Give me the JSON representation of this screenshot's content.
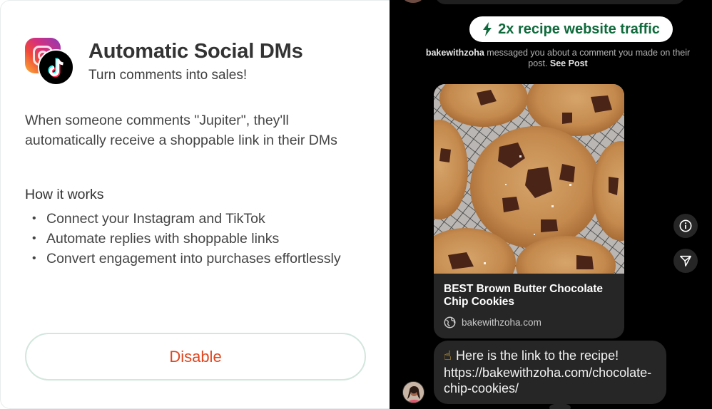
{
  "left_panel": {
    "title": "Automatic Social DMs",
    "subtitle": "Turn comments into sales!",
    "description": "When someone comments \"Jupiter\", they'll automatically receive a shoppable link in their DMs",
    "how_it_works_heading": "How it works",
    "bullets": [
      "Connect your Instagram and TikTok",
      "Automate replies with shoppable links",
      "Convert engagement into purchases effortlessly"
    ],
    "disable_label": "Disable",
    "icons": [
      "instagram-logo",
      "tiktok-logo"
    ]
  },
  "preview": {
    "badge_text": "2x recipe website traffic",
    "badge_icon": "lightning-icon",
    "notice_user": "bakewithzoha",
    "notice_text": "messaged you about a comment you made on their post.",
    "notice_link": "See Post",
    "card": {
      "title": "BEST Brown Butter Chocolate Chip Cookies",
      "site": "bakewithzoha.com"
    },
    "message_emoji": "☝",
    "message_text": "Here is the link to the recipe!",
    "message_link": "https://bakewithzoha.com/chocolate-chip-cookies/",
    "side_icons": [
      "info-icon",
      "send-icon"
    ]
  },
  "colors": {
    "accent_green": "#0e6a3b",
    "disable_red": "#e0461f",
    "button_border": "#d3e6dd",
    "dark_bg": "#000000",
    "bubble_bg": "#262626"
  }
}
